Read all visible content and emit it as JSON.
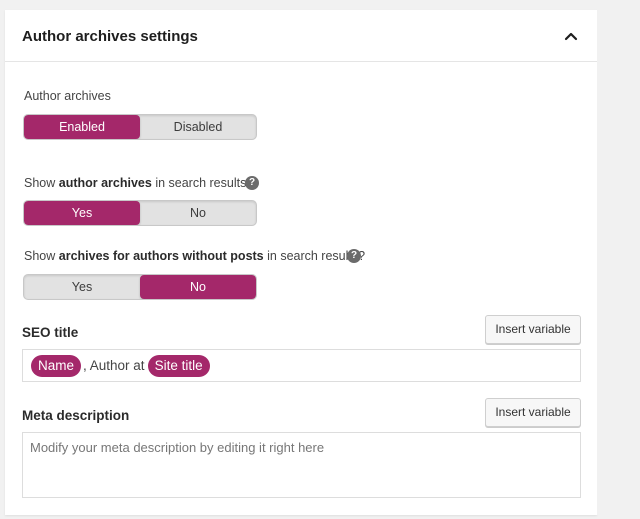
{
  "panel": {
    "title": "Author archives settings",
    "collapse_icon": "chevron-up-icon"
  },
  "author_archives": {
    "label": "Author archives",
    "options": [
      "Enabled",
      "Disabled"
    ],
    "selected": "Enabled"
  },
  "show_author_archives": {
    "label_prefix": "Show ",
    "label_bold": "author archives",
    "label_suffix": " in search results?",
    "help_icon": "?",
    "options": [
      "Yes",
      "No"
    ],
    "selected": "Yes"
  },
  "show_archives_without_posts": {
    "label_prefix": "Show ",
    "label_bold": "archives for authors without posts",
    "label_suffix": " in search results?",
    "help_icon": "?",
    "options": [
      "Yes",
      "No"
    ],
    "selected": "No"
  },
  "seo_title": {
    "label": "SEO title",
    "insert_button": "Insert variable",
    "var_name": "Name",
    "separator": ", Author at",
    "var_site_title": "Site title"
  },
  "meta_description": {
    "label": "Meta description",
    "insert_button": "Insert variable",
    "placeholder": "Modify your meta description by editing it right here"
  },
  "colors": {
    "accent": "#a4286a",
    "toggle_bg": "#e2e2e2",
    "page_bg": "#f1f1f1"
  }
}
